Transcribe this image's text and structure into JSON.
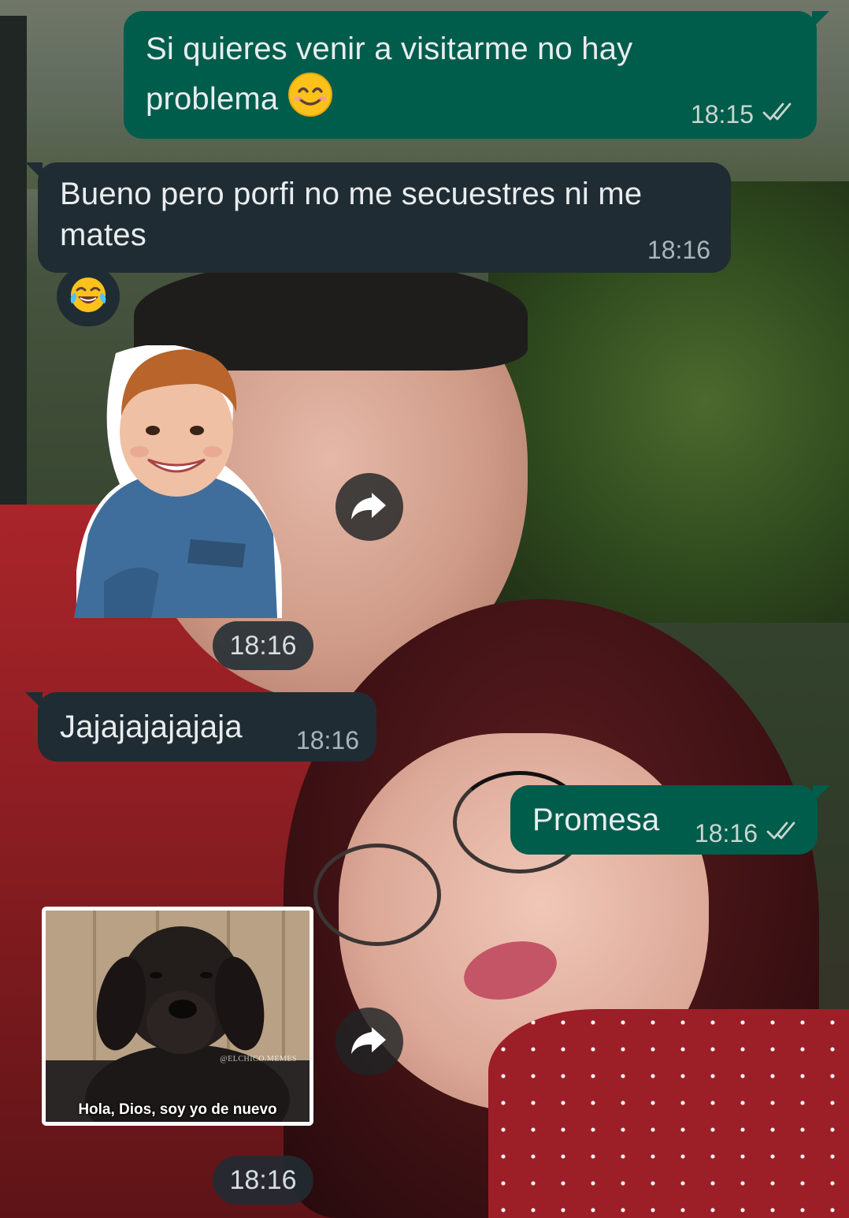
{
  "messages": [
    {
      "id": "m1",
      "direction": "outgoing",
      "text_line1": "Si quieres venir a visitarme no hay",
      "text_line2": "problema",
      "emoji": "smiling-face-with-smiling-eyes",
      "time": "18:15",
      "status": "read-double-check"
    },
    {
      "id": "m2",
      "direction": "incoming",
      "text_line1": "Bueno pero porfi no me secuestres ni me",
      "text_line2": "mates",
      "time": "18:16",
      "reaction": "face-with-tears-of-joy"
    },
    {
      "id": "m3",
      "direction": "incoming",
      "type": "sticker",
      "sticker": "smiling-boy-sticker",
      "time": "18:16"
    },
    {
      "id": "m4",
      "direction": "incoming",
      "text": "Jajajajajajaja",
      "time": "18:16"
    },
    {
      "id": "m5",
      "direction": "outgoing",
      "text": "Promesa",
      "time": "18:16",
      "status": "read-double-check"
    },
    {
      "id": "m6",
      "direction": "incoming",
      "type": "sticker",
      "sticker": "dog-meme-sticker",
      "caption": "Hola, Dios, soy yo de nuevo",
      "watermark": "@ELCHICO.MEMES",
      "time": "18:16"
    }
  ],
  "icons": {
    "forward": "forward-arrow-icon",
    "read": "double-check-icon"
  },
  "colors": {
    "outgoing_bubble": "#005c4b",
    "incoming_bubble": "#202c33",
    "text": "#e9edef",
    "meta": "#c9d6d1"
  }
}
